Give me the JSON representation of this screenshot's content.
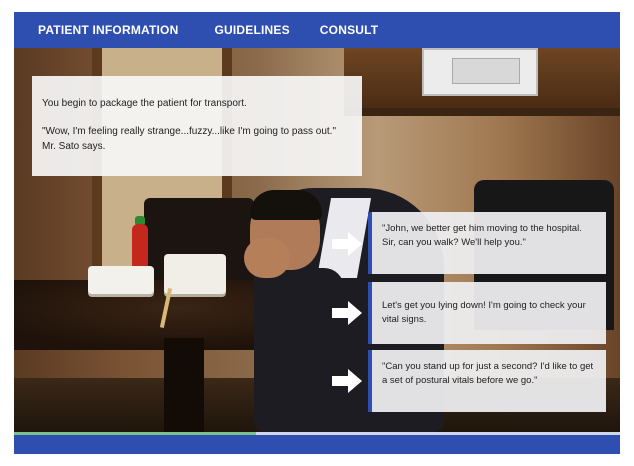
{
  "nav": {
    "items": [
      "PATIENT INFORMATION",
      "GUIDELINES",
      "CONSULT"
    ]
  },
  "narration": {
    "line1": "You begin to package the patient for transport.",
    "line2": "\"Wow, I'm feeling really strange...fuzzy...like I'm going to pass out.\" Mr. Sato says."
  },
  "options": [
    "\"John, we better get him moving to the hospital. Sir, can you walk? We'll help you.\"",
    "Let's get you lying down! I'm going to check your vital signs.",
    "\"Can you stand up for just a second? I'd like to get a set of postural vitals before we go.\""
  ],
  "progress": {
    "fraction": 0.4
  },
  "colors": {
    "accent": "#2f4fb0",
    "progress": "#7ac08a"
  },
  "icons": {
    "option_arrow": "arrow-right-icon"
  }
}
